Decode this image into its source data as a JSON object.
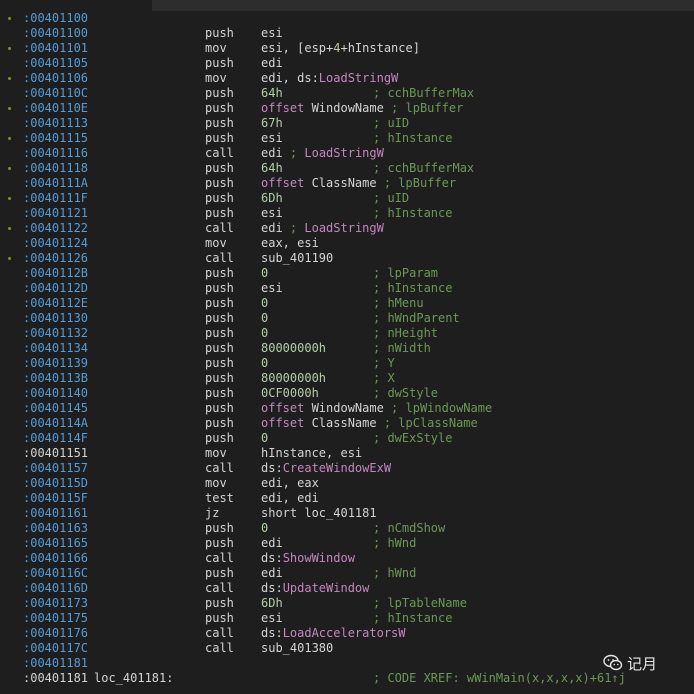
{
  "watermark": "记月",
  "rows": [
    {
      "addr": ":00401100",
      "dot": true
    },
    {
      "addr": ":00401100",
      "mnem": "push",
      "ops": [
        [
          "txt",
          "esi"
        ]
      ]
    },
    {
      "addr": ":00401101",
      "mnem": "mov",
      "ops": [
        [
          "txt",
          "esi, [esp+"
        ],
        [
          "num",
          "4"
        ],
        [
          "txt",
          "+hInstance]"
        ]
      ]
    },
    {
      "addr": ":00401105",
      "mnem": "push",
      "ops": [
        [
          "txt",
          "edi"
        ]
      ]
    },
    {
      "addr": ":00401106",
      "mnem": "mov",
      "ops": [
        [
          "txt",
          "edi, ds:"
        ],
        [
          "fn",
          "LoadStringW"
        ]
      ]
    },
    {
      "addr": ":0040110C",
      "mnem": "push",
      "ops": [
        [
          "num",
          "64h"
        ]
      ],
      "cmt": "; cchBufferMax"
    },
    {
      "addr": ":0040110E",
      "mnem": "push",
      "ops": [
        [
          "kw",
          "offset "
        ],
        [
          "txt",
          "WindowName"
        ],
        [
          "grn",
          " ; lpBuffer"
        ]
      ]
    },
    {
      "addr": ":00401113",
      "mnem": "push",
      "ops": [
        [
          "num",
          "67h"
        ]
      ],
      "cmt": "; uID"
    },
    {
      "addr": ":00401115",
      "mnem": "push",
      "ops": [
        [
          "txt",
          "esi"
        ]
      ],
      "cmt": "; hInstance"
    },
    {
      "addr": ":00401116",
      "mnem": "call",
      "ops": [
        [
          "txt",
          "edi"
        ],
        [
          "grn",
          " ; "
        ],
        [
          "fn",
          "LoadStringW"
        ]
      ]
    },
    {
      "addr": ":00401118",
      "mnem": "push",
      "ops": [
        [
          "num",
          "64h"
        ]
      ],
      "cmt": "; cchBufferMax"
    },
    {
      "addr": ":0040111A",
      "mnem": "push",
      "ops": [
        [
          "kw",
          "offset "
        ],
        [
          "txt",
          "ClassName"
        ],
        [
          "grn",
          " ; lpBuffer"
        ]
      ]
    },
    {
      "addr": ":0040111F",
      "mnem": "push",
      "ops": [
        [
          "num",
          "6Dh"
        ]
      ],
      "cmt": "; uID"
    },
    {
      "addr": ":00401121",
      "mnem": "push",
      "ops": [
        [
          "txt",
          "esi"
        ]
      ],
      "cmt": "; hInstance"
    },
    {
      "addr": ":00401122",
      "mnem": "call",
      "ops": [
        [
          "txt",
          "edi"
        ],
        [
          "grn",
          " ; "
        ],
        [
          "fn",
          "LoadStringW"
        ]
      ]
    },
    {
      "addr": ":00401124",
      "mnem": "mov",
      "ops": [
        [
          "txt",
          "eax, esi"
        ]
      ]
    },
    {
      "addr": ":00401126",
      "mnem": "call",
      "ops": [
        [
          "txt",
          "sub_401190"
        ]
      ]
    },
    {
      "addr": ":0040112B",
      "mnem": "push",
      "ops": [
        [
          "num",
          "0"
        ]
      ],
      "cmt": "; lpParam"
    },
    {
      "addr": ":0040112D",
      "mnem": "push",
      "ops": [
        [
          "txt",
          "esi"
        ]
      ],
      "cmt": "; hInstance"
    },
    {
      "addr": ":0040112E",
      "mnem": "push",
      "ops": [
        [
          "num",
          "0"
        ]
      ],
      "cmt": "; hMenu"
    },
    {
      "addr": ":00401130",
      "mnem": "push",
      "ops": [
        [
          "num",
          "0"
        ]
      ],
      "cmt": "; hWndParent"
    },
    {
      "addr": ":00401132",
      "mnem": "push",
      "ops": [
        [
          "num",
          "0"
        ]
      ],
      "cmt": "; nHeight"
    },
    {
      "addr": ":00401134",
      "mnem": "push",
      "ops": [
        [
          "num",
          "80000000h"
        ]
      ],
      "cmt": "; nWidth"
    },
    {
      "addr": ":00401139",
      "mnem": "push",
      "ops": [
        [
          "num",
          "0"
        ]
      ],
      "cmt": "; Y"
    },
    {
      "addr": ":0040113B",
      "mnem": "push",
      "ops": [
        [
          "num",
          "80000000h"
        ]
      ],
      "cmt": "; X"
    },
    {
      "addr": ":00401140",
      "mnem": "push",
      "ops": [
        [
          "num",
          "0CF0000h"
        ]
      ],
      "cmt": "; dwStyle"
    },
    {
      "addr": ":00401145",
      "mnem": "push",
      "ops": [
        [
          "kw",
          "offset "
        ],
        [
          "txt",
          "WindowName"
        ],
        [
          "grn",
          " ; lpWindowName"
        ]
      ]
    },
    {
      "addr": ":0040114A",
      "mnem": "push",
      "ops": [
        [
          "kw",
          "offset "
        ],
        [
          "txt",
          "ClassName"
        ],
        [
          "grn",
          " ; lpClassName"
        ]
      ]
    },
    {
      "addr": ":0040114F",
      "mnem": "push",
      "ops": [
        [
          "num",
          "0"
        ]
      ],
      "cmt": "; dwExStyle"
    },
    {
      "addr": ":00401151",
      "white": true,
      "mnem": "mov",
      "ops": [
        [
          "txt",
          "hInstance, esi"
        ]
      ]
    },
    {
      "addr": ":00401157",
      "mnem": "call",
      "ops": [
        [
          "txt",
          "ds:"
        ],
        [
          "fn",
          "CreateWindowExW"
        ]
      ]
    },
    {
      "addr": ":0040115D",
      "mnem": "mov",
      "ops": [
        [
          "txt",
          "edi, eax"
        ]
      ]
    },
    {
      "addr": ":0040115F",
      "mnem": "test",
      "ops": [
        [
          "txt",
          "edi, edi"
        ]
      ]
    },
    {
      "addr": ":00401161",
      "mnem": "jz",
      "ops": [
        [
          "txt",
          "short loc_401181"
        ]
      ]
    },
    {
      "addr": ":00401163",
      "mnem": "push",
      "ops": [
        [
          "num",
          "0"
        ]
      ],
      "cmt": "; nCmdShow"
    },
    {
      "addr": ":00401165",
      "mnem": "push",
      "ops": [
        [
          "txt",
          "edi"
        ]
      ],
      "cmt": "; hWnd"
    },
    {
      "addr": ":00401166",
      "mnem": "call",
      "ops": [
        [
          "txt",
          "ds:"
        ],
        [
          "fn",
          "ShowWindow"
        ]
      ]
    },
    {
      "addr": ":0040116C",
      "mnem": "push",
      "ops": [
        [
          "txt",
          "edi"
        ]
      ],
      "cmt": "; hWnd"
    },
    {
      "addr": ":0040116D",
      "mnem": "call",
      "ops": [
        [
          "txt",
          "ds:"
        ],
        [
          "fn",
          "UpdateWindow"
        ]
      ]
    },
    {
      "addr": ":00401173",
      "mnem": "push",
      "ops": [
        [
          "num",
          "6Dh"
        ]
      ],
      "cmt": "; lpTableName"
    },
    {
      "addr": ":00401175",
      "mnem": "push",
      "ops": [
        [
          "txt",
          "esi"
        ]
      ],
      "cmt": "; hInstance"
    },
    {
      "addr": ":00401176",
      "mnem": "call",
      "ops": [
        [
          "txt",
          "ds:"
        ],
        [
          "fn",
          "LoadAcceleratorsW"
        ]
      ]
    },
    {
      "addr": ":0040117C",
      "mnem": "call",
      "ops": [
        [
          "txt",
          "sub_401380"
        ]
      ]
    },
    {
      "addr": ":00401181"
    },
    {
      "addr": ":00401181",
      "white": true,
      "label": "loc_401181:",
      "cmt": "; CODE XREF: wWinMain(x,x,x,x)+61↑j"
    }
  ]
}
